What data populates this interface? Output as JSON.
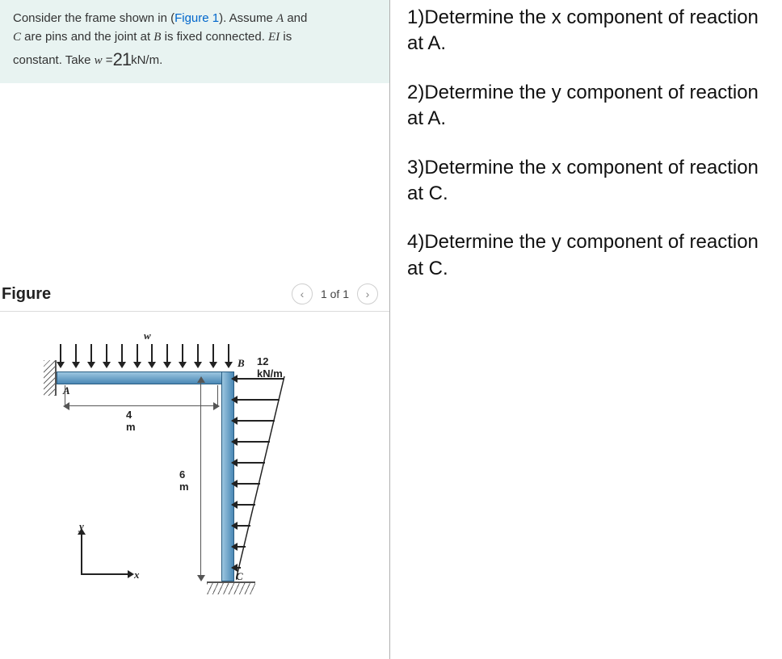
{
  "problem": {
    "line1_a": "Consider the frame shown in (",
    "fig_link": "Figure 1",
    "line1_b": "). Assume ",
    "A": "A",
    "line1_c": " and",
    "C": "C",
    "line2_a": " are pins and the joint at ",
    "B": "B",
    "line2_b": " is fixed connected. ",
    "EI": "EI",
    "line2_c": " is",
    "line3_a": "constant. Take ",
    "w": "w",
    "eq": " =",
    "wval": "21",
    "unit": "kN/m",
    "dot": "."
  },
  "figure": {
    "title": "Figure",
    "pager": "1 of 1"
  },
  "diagram": {
    "w_label": "w",
    "B": "B",
    "load_right": "12 kN/m",
    "A": "A",
    "dim4": "4 m",
    "dim6": "6 m",
    "C": "C",
    "y": "y",
    "x": "x"
  },
  "questions": {
    "q1": "1)Determine the x component of reaction at A.",
    "q2": "2)Determine the y component of reaction at A.",
    "q3": "3)Determine the x component of reaction at C.",
    "q4": "4)Determine the y component of reaction at C."
  }
}
